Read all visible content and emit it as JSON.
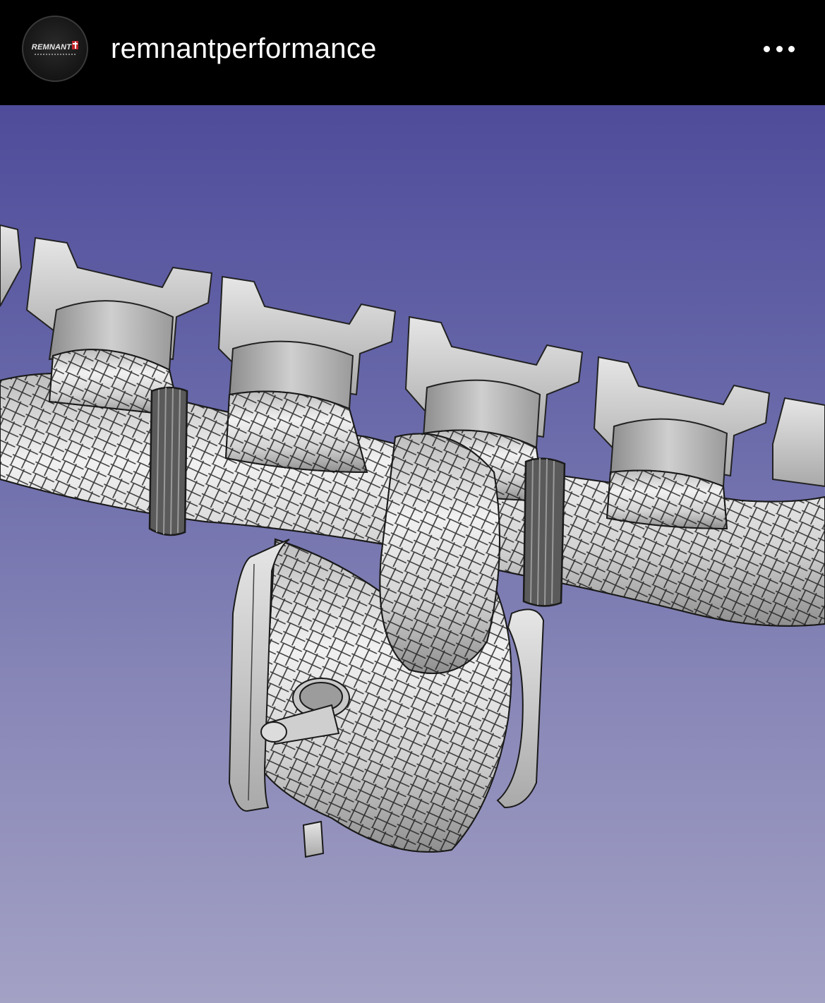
{
  "post": {
    "account": {
      "avatar_text": "REMNANT",
      "username": "remnantperformance"
    },
    "media": {
      "subject": "cad-exhaust-manifold-mesh",
      "background_top": "#4f4c9a",
      "background_bottom": "#a3a1c4"
    },
    "icons": {
      "more": "more-horizontal-icon"
    }
  }
}
